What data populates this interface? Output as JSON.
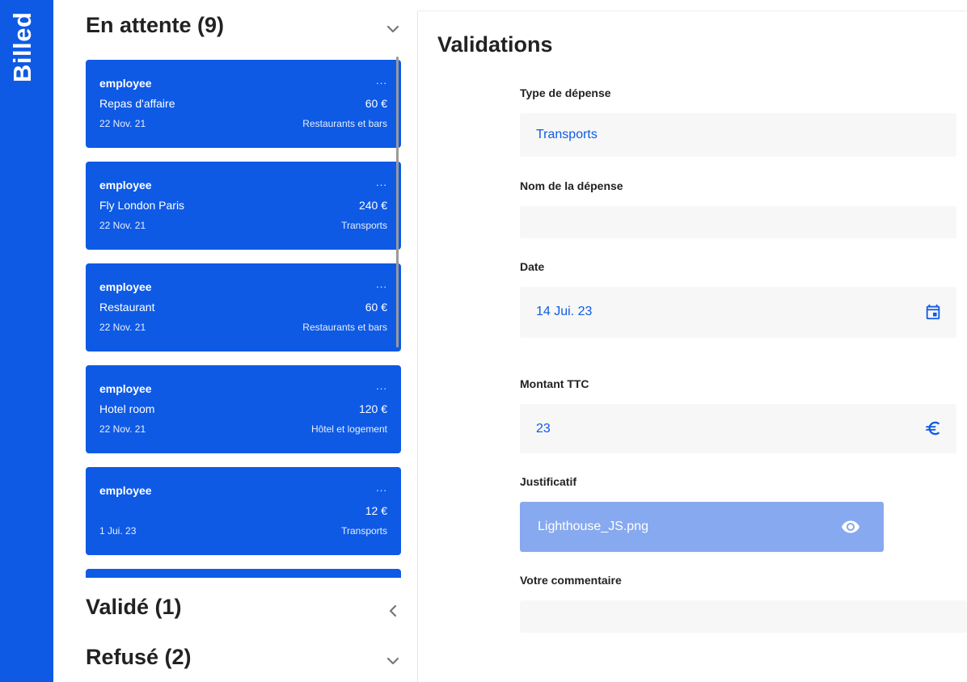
{
  "app": {
    "logo": "Billed"
  },
  "sections": {
    "pending": {
      "title": "En attente (9)"
    },
    "validated": {
      "title": "Validé (1)"
    },
    "refused": {
      "title": "Refusé (2)"
    }
  },
  "bills": [
    {
      "name": "employee",
      "more": "...",
      "label": "Repas d'affaire",
      "amount": "60 €",
      "date": "22 Nov. 21",
      "type": "Restaurants et bars"
    },
    {
      "name": "employee",
      "more": "...",
      "label": "Fly London Paris",
      "amount": "240 €",
      "date": "22 Nov. 21",
      "type": "Transports"
    },
    {
      "name": "employee",
      "more": "...",
      "label": "Restaurant",
      "amount": "60 €",
      "date": "22 Nov. 21",
      "type": "Restaurants et bars"
    },
    {
      "name": "employee",
      "more": "...",
      "label": "Hotel room",
      "amount": "120 €",
      "date": "22 Nov. 21",
      "type": "Hôtel et logement"
    },
    {
      "name": "employee",
      "more": "...",
      "label": "",
      "amount": "12 €",
      "date": "1 Jui. 23",
      "type": "Transports"
    }
  ],
  "form": {
    "title": "Validations",
    "expense_type": {
      "label": "Type de dépense",
      "value": "Transports"
    },
    "expense_name": {
      "label": "Nom de la dépense",
      "value": ""
    },
    "date": {
      "label": "Date",
      "value": "14 Jui. 23",
      "icon": "calendar-icon"
    },
    "amount": {
      "label": "Montant TTC",
      "value": "23",
      "icon": "euro-icon"
    },
    "proof": {
      "label": "Justificatif",
      "file": "Lighthouse_JS.png",
      "icon": "eye-icon"
    },
    "comment": {
      "label": "Votre commentaire",
      "value": ""
    }
  },
  "colors": {
    "brand": "#0E5AE5",
    "file_bg": "#87A9EF",
    "field_bg": "#F7F7F7"
  }
}
